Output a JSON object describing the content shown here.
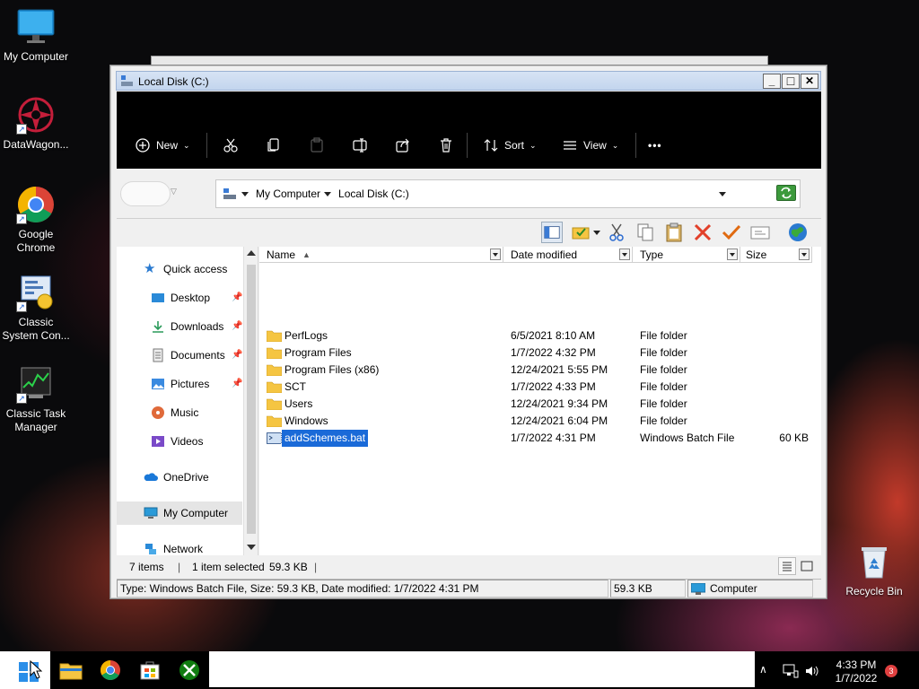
{
  "desktop": {
    "icons": [
      {
        "label": "My Computer"
      },
      {
        "label": "DataWagon..."
      },
      {
        "label": "Google Chrome"
      },
      {
        "label": "Classic System Con..."
      },
      {
        "label": "Classic Task Manager"
      },
      {
        "label": "Recycle Bin"
      }
    ]
  },
  "window": {
    "title": "Local Disk (C:)",
    "controls": {
      "minimize": "_",
      "maximize": "□",
      "close": "✕"
    }
  },
  "ribbon": {
    "new_label": "New",
    "sort_label": "Sort",
    "view_label": "View",
    "more_label": "•••"
  },
  "address": {
    "segments": [
      "My Computer",
      "Local Disk (C:)"
    ]
  },
  "navpane": {
    "items": [
      {
        "label": "Quick access"
      },
      {
        "label": "Desktop"
      },
      {
        "label": "Downloads"
      },
      {
        "label": "Documents"
      },
      {
        "label": "Pictures"
      },
      {
        "label": "Music"
      },
      {
        "label": "Videos"
      },
      {
        "label": "OneDrive"
      },
      {
        "label": "My Computer"
      },
      {
        "label": "Network"
      }
    ]
  },
  "filelist": {
    "columns": [
      "Name",
      "Date modified",
      "Type",
      "Size"
    ],
    "rows": [
      {
        "name": "PerfLogs",
        "date": "6/5/2021 8:10 AM",
        "type": "File folder",
        "size": ""
      },
      {
        "name": "Program Files",
        "date": "1/7/2022 4:32 PM",
        "type": "File folder",
        "size": ""
      },
      {
        "name": "Program Files (x86)",
        "date": "12/24/2021 5:55 PM",
        "type": "File folder",
        "size": ""
      },
      {
        "name": "SCT",
        "date": "1/7/2022 4:33 PM",
        "type": "File folder",
        "size": ""
      },
      {
        "name": "Users",
        "date": "12/24/2021 9:34 PM",
        "type": "File folder",
        "size": ""
      },
      {
        "name": "Windows",
        "date": "12/24/2021 6:04 PM",
        "type": "File folder",
        "size": ""
      },
      {
        "name": "addSchemes.bat",
        "date": "1/7/2022 4:31 PM",
        "type": "Windows Batch File",
        "size": "60 KB"
      }
    ]
  },
  "status": {
    "item_count": "7 items",
    "selected": "1 item selected",
    "selected_size": "59.3 KB"
  },
  "infobar": {
    "details": "Type: Windows Batch File, Size: 59.3 KB, Date modified: 1/7/2022 4:31 PM",
    "size": "59.3 KB",
    "location": "Computer"
  },
  "taskbar": {
    "time": "4:33 PM",
    "date": "1/7/2022",
    "notification_count": "3"
  },
  "colors": {
    "selection": "#1a6ad8",
    "ribbon_bg": "#000000",
    "title_bg": "#c3d5ee"
  }
}
